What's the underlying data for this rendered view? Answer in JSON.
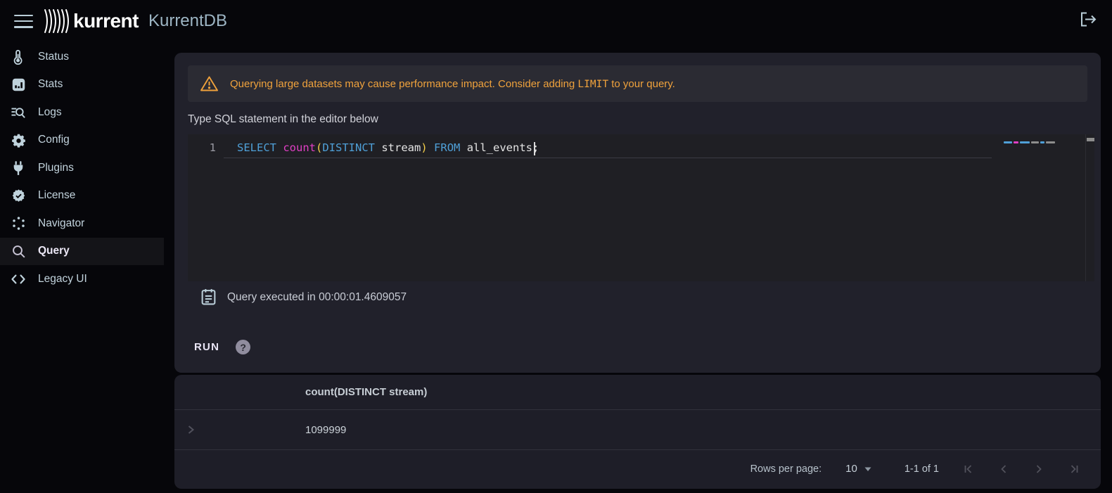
{
  "app": {
    "brand": "kurrent",
    "product": "KurrentDB"
  },
  "colors": {
    "page_bg": "#06060a",
    "panel_bg": "#21212b",
    "banner_bg": "#2b2b33",
    "editor_bg": "#1f1f24",
    "results_bg": "#1e1e28",
    "warning_text": "#f0a23c",
    "sidebar_icon": "#bfd2dc",
    "active_item_bg": "#141418",
    "syntax_keyword": "#4fa0d8",
    "syntax_function": "#e03fc4",
    "syntax_paren": "#f3ce49",
    "syntax_plain": "#e3e3e3"
  },
  "sidebar": {
    "items": [
      {
        "label": "Status",
        "icon": "thermometer-icon",
        "active": false
      },
      {
        "label": "Stats",
        "icon": "bar-chart-icon",
        "active": false
      },
      {
        "label": "Logs",
        "icon": "log-search-icon",
        "active": false
      },
      {
        "label": "Config",
        "icon": "gear-icon",
        "active": false
      },
      {
        "label": "Plugins",
        "icon": "plug-icon",
        "active": false
      },
      {
        "label": "License",
        "icon": "license-badge-icon",
        "active": false
      },
      {
        "label": "Navigator",
        "icon": "spinner-dots-icon",
        "active": false
      },
      {
        "label": "Query",
        "icon": "magnifier-icon",
        "active": true
      },
      {
        "label": "Legacy UI",
        "icon": "code-brackets-icon",
        "active": false
      }
    ]
  },
  "query_panel": {
    "warning": {
      "text_before": "Querying large datasets may cause performance impact. Consider adding ",
      "code": "LIMIT",
      "text_after": " to your query."
    },
    "editor_hint": "Type SQL statement in the editor below",
    "editor": {
      "line_number": "1",
      "full_text": "SELECT count(DISTINCT stream) FROM all_events;",
      "tokens": [
        {
          "text": "SELECT",
          "type": "keyword"
        },
        {
          "text": " ",
          "type": "plain"
        },
        {
          "text": "count",
          "type": "function"
        },
        {
          "text": "(",
          "type": "paren"
        },
        {
          "text": "DISTINCT",
          "type": "keyword"
        },
        {
          "text": " stream",
          "type": "plain"
        },
        {
          "text": ")",
          "type": "paren"
        },
        {
          "text": " ",
          "type": "plain"
        },
        {
          "text": "FROM",
          "type": "keyword"
        },
        {
          "text": " all_events;",
          "type": "plain"
        }
      ]
    },
    "executed_message": "Query executed in 00:00:01.4609057",
    "run_label": "RUN",
    "help_glyph": "?"
  },
  "results": {
    "columns": [
      "count(DISTINCT stream)"
    ],
    "rows": [
      {
        "value": "1099999"
      }
    ],
    "pagination": {
      "rows_per_page_label": "Rows per page:",
      "rows_per_page_value": "10",
      "range_label": "1-1 of 1"
    }
  }
}
